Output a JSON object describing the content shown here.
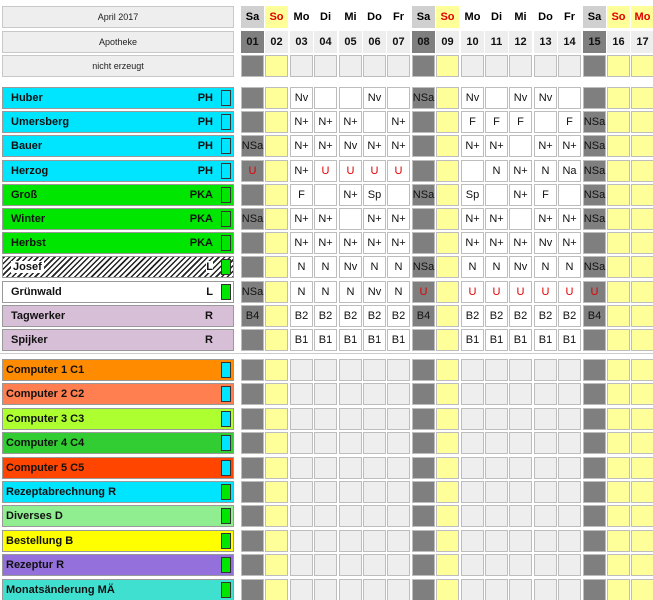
{
  "header": {
    "month": "April 2017",
    "branch": "Apotheke",
    "status": "nicht erzeugt"
  },
  "days": [
    {
      "name": "Sa",
      "num": "01",
      "type": "sat"
    },
    {
      "name": "So",
      "num": "02",
      "type": "sun"
    },
    {
      "name": "Mo",
      "num": "03",
      "type": "wd"
    },
    {
      "name": "Di",
      "num": "04",
      "type": "wd"
    },
    {
      "name": "Mi",
      "num": "05",
      "type": "wd"
    },
    {
      "name": "Do",
      "num": "06",
      "type": "wd"
    },
    {
      "name": "Fr",
      "num": "07",
      "type": "wd"
    },
    {
      "name": "Sa",
      "num": "08",
      "type": "sat"
    },
    {
      "name": "So",
      "num": "09",
      "type": "sun"
    },
    {
      "name": "Mo",
      "num": "10",
      "type": "wd"
    },
    {
      "name": "Di",
      "num": "11",
      "type": "wd"
    },
    {
      "name": "Mi",
      "num": "12",
      "type": "wd"
    },
    {
      "name": "Do",
      "num": "13",
      "type": "wd"
    },
    {
      "name": "Fr",
      "num": "14",
      "type": "wd"
    },
    {
      "name": "Sa",
      "num": "15",
      "type": "sat"
    },
    {
      "name": "So",
      "num": "16",
      "type": "sun"
    },
    {
      "name": "Mo",
      "num": "17",
      "type": "mored"
    }
  ],
  "employees": [
    {
      "name": "Huber",
      "role": "PH",
      "color": "#00e5ff",
      "marker": "#00e5ff",
      "style": "solid",
      "cells": [
        "",
        "",
        "Nv",
        "",
        "",
        "Nv",
        "",
        "NSa",
        "",
        "Nv",
        "",
        "Nv",
        "Nv",
        "",
        "",
        "",
        ""
      ]
    },
    {
      "name": "Umersberg",
      "role": "PH",
      "color": "#00e5ff",
      "marker": "#00e5ff",
      "style": "solid",
      "cells": [
        "",
        "",
        "N+",
        "N+",
        "N+",
        "",
        "N+",
        "",
        "",
        "F",
        "F",
        "F",
        "",
        "F",
        "NSa",
        "",
        ""
      ]
    },
    {
      "name": "Bauer",
      "role": "PH",
      "color": "#00e5ff",
      "marker": "#00e5ff",
      "style": "solid",
      "cells": [
        "NSa",
        "",
        "N+",
        "N+",
        "Nv",
        "N+",
        "N+",
        "",
        "",
        "N+",
        "N+",
        "",
        "N+",
        "N+",
        "NSa",
        "",
        ""
      ]
    },
    {
      "name": "Herzog",
      "role": "PH",
      "color": "#00e5ff",
      "marker": "#00e5ff",
      "style": "solid",
      "cells": [
        "U",
        "",
        "N+",
        "U",
        "U",
        "U",
        "U",
        "",
        "",
        "",
        "N",
        "N+",
        "N",
        "Na",
        "NSa",
        "",
        ""
      ]
    },
    {
      "name": "Groß",
      "role": "PKA",
      "color": "#00e600",
      "marker": "#00e600",
      "style": "solid",
      "cells": [
        "",
        "",
        "F",
        "",
        "N+",
        "Sp",
        "",
        "NSa",
        "",
        "Sp",
        "",
        "N+",
        "F",
        "",
        "NSa",
        "",
        ""
      ]
    },
    {
      "name": "Winter",
      "role": "PKA",
      "color": "#00e600",
      "marker": "#00e600",
      "style": "solid",
      "cells": [
        "NSa",
        "",
        "N+",
        "N+",
        "",
        "N+",
        "N+",
        "",
        "",
        "N+",
        "N+",
        "",
        "N+",
        "N+",
        "NSa",
        "",
        ""
      ]
    },
    {
      "name": "Herbst",
      "role": "PKA",
      "color": "#00e600",
      "marker": "#00e600",
      "style": "solid",
      "cells": [
        "",
        "",
        "N+",
        "N+",
        "N+",
        "N+",
        "N+",
        "",
        "",
        "N+",
        "N+",
        "N+",
        "Nv",
        "N+",
        "",
        "",
        ""
      ]
    },
    {
      "name": "Josef",
      "role": "L",
      "color": "#ffffff",
      "marker": "#00e600",
      "style": "hatch",
      "cells": [
        "",
        "",
        "N",
        "N",
        "Nv",
        "N",
        "N",
        "NSa",
        "",
        "N",
        "N",
        "Nv",
        "N",
        "N",
        "NSa",
        "",
        ""
      ]
    },
    {
      "name": "Grünwald",
      "role": "L",
      "color": "#ffffff",
      "marker": "#00e600",
      "style": "solid",
      "cells": [
        "NSa",
        "",
        "N",
        "N",
        "N",
        "Nv",
        "N",
        "U",
        "",
        "U",
        "U",
        "U",
        "U",
        "U",
        "U",
        "",
        ""
      ]
    },
    {
      "name": "Tagwerker",
      "role": "R",
      "color": "#d8bfd8",
      "marker": "",
      "style": "solid",
      "cells": [
        "B4",
        "",
        "B2",
        "B2",
        "B2",
        "B2",
        "B2",
        "B4",
        "",
        "B2",
        "B2",
        "B2",
        "B2",
        "B2",
        "B4",
        "",
        ""
      ]
    },
    {
      "name": "Spijker",
      "role": "R",
      "color": "#d8bfd8",
      "marker": "",
      "style": "solid",
      "cells": [
        "",
        "",
        "B1",
        "B1",
        "B1",
        "B1",
        "B1",
        "",
        "",
        "B1",
        "B1",
        "B1",
        "B1",
        "B1",
        "",
        "",
        ""
      ]
    }
  ],
  "tasks": [
    {
      "name": "Computer 1 C1",
      "color": "#ff8c00",
      "marker": "#00e5ff"
    },
    {
      "name": "Computer 2 C2",
      "color": "#ff7f50",
      "marker": "#00e5ff"
    },
    {
      "name": "Computer 3 C3",
      "color": "#adff2f",
      "marker": "#00e5ff"
    },
    {
      "name": "Computer 4 C4",
      "color": "#32cd32",
      "marker": "#00e5ff"
    },
    {
      "name": "Computer 5 C5",
      "color": "#ff4500",
      "marker": "#00e5ff"
    },
    {
      "name": "Rezeptabrechnung R",
      "color": "#00e5ff",
      "marker": "#00e600"
    },
    {
      "name": "Diverses D",
      "color": "#90ee90",
      "marker": "#00e600"
    },
    {
      "name": "Bestellung B",
      "color": "#ffff00",
      "marker": "#00e600"
    },
    {
      "name": "Rezeptur R",
      "color": "#9370db",
      "marker": "#00e600"
    },
    {
      "name": "Monatsänderung MÄ",
      "color": "#40e0d0",
      "marker": "#00e600"
    }
  ]
}
